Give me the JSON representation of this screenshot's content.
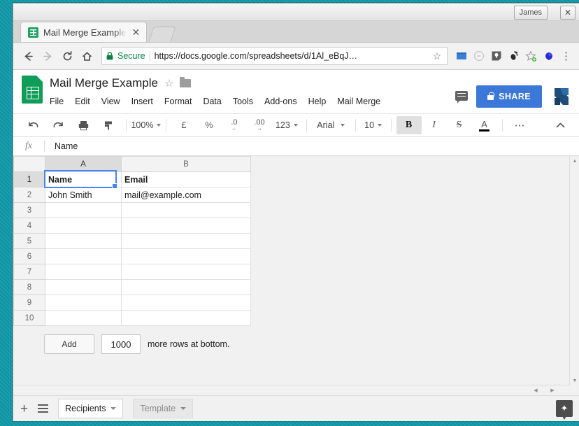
{
  "window": {
    "user_button": "James",
    "close_button": "✕"
  },
  "browser": {
    "tab": {
      "title": "Mail Merge Example",
      "favicon": "sheets-favicon",
      "close": "✕"
    },
    "new_tab_label": "",
    "nav": {
      "back": "←",
      "forward": "→",
      "reload": "↻",
      "home": "⌂"
    },
    "address": {
      "security_label": "Secure",
      "url": "https://docs.google.com/spreadsheets/d/1Al_eBqJ…",
      "bookmark_star": "☆"
    },
    "menu_button": "⋮"
  },
  "doc": {
    "title": "Mail Merge Example",
    "star": "☆",
    "menus": [
      "File",
      "Edit",
      "View",
      "Insert",
      "Format",
      "Data",
      "Tools",
      "Add-ons",
      "Help",
      "Mail Merge"
    ],
    "share_label": "SHARE"
  },
  "toolbar": {
    "undo": "↶",
    "redo": "↷",
    "print": "⎙",
    "paint_format": "⚑",
    "zoom": "100%",
    "currency": "£",
    "percent": "%",
    "decrease_decimal": ".0",
    "increase_decimal": ".00",
    "number_format": "123",
    "font_name": "Arial",
    "font_size": "10",
    "bold": "B",
    "italic": "I",
    "strikethrough": "S",
    "text_color": "A",
    "more": "⋯",
    "collapse": "⌃"
  },
  "formula_bar": {
    "fx": "fx",
    "value": "Name"
  },
  "grid": {
    "columns": [
      "A",
      "B"
    ],
    "selected_column": "A",
    "selected_row": "1",
    "selected_cell": "A1",
    "rows": [
      {
        "num": "1",
        "cells": [
          "Name",
          "Email"
        ],
        "bold": true
      },
      {
        "num": "2",
        "cells": [
          "John Smith",
          "mail@example.com"
        ],
        "bold": false
      },
      {
        "num": "3",
        "cells": [
          "",
          ""
        ],
        "bold": false
      },
      {
        "num": "4",
        "cells": [
          "",
          ""
        ],
        "bold": false
      },
      {
        "num": "5",
        "cells": [
          "",
          ""
        ],
        "bold": false
      },
      {
        "num": "6",
        "cells": [
          "",
          ""
        ],
        "bold": false
      },
      {
        "num": "7",
        "cells": [
          "",
          ""
        ],
        "bold": false
      },
      {
        "num": "8",
        "cells": [
          "",
          ""
        ],
        "bold": false
      },
      {
        "num": "9",
        "cells": [
          "",
          ""
        ],
        "bold": false
      },
      {
        "num": "10",
        "cells": [
          "",
          ""
        ],
        "bold": false
      }
    ]
  },
  "add_rows": {
    "button_label": "Add",
    "count_value": "1000",
    "suffix_text": "more rows at bottom."
  },
  "sheet_bar": {
    "add_sheet": "+",
    "all_sheets": "all-sheets-icon",
    "tabs": [
      {
        "name": "Recipients",
        "active": true
      },
      {
        "name": "Template",
        "active": false
      }
    ],
    "explore": "✦"
  },
  "colors": {
    "desktop": "#1796a8",
    "share_blue": "#3c78d8",
    "sheets_green": "#0f9d58",
    "secure_green": "#0b8043",
    "selection_blue": "#4285f4"
  }
}
